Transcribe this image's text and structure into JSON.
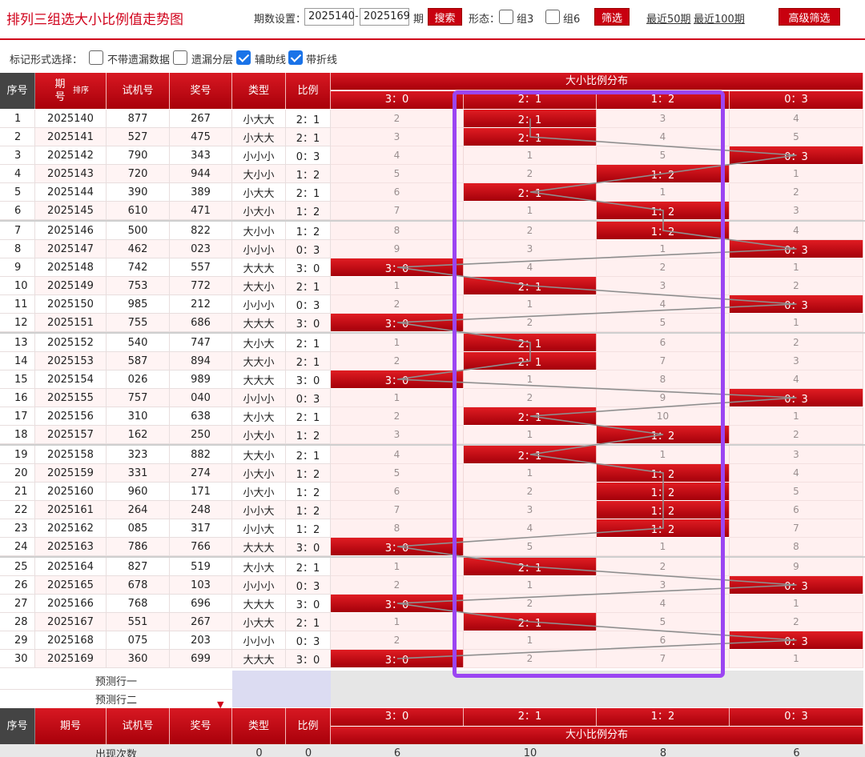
{
  "header": {
    "title": "排列三组选大小比例值走势图",
    "period_label": "期数设置：",
    "period_from": "2025140",
    "dash": "-",
    "period_to": "2025169",
    "period_unit": "期",
    "search_label": "搜索",
    "form_label": "形态：",
    "group3_label": "组3",
    "group6_label": "组6",
    "filter_label": "筛选",
    "recent50": "最近50期",
    "recent100": "最近100期",
    "advanced_label": "高级筛选"
  },
  "mark": {
    "label": "标记形式选择：",
    "opt1": "不带遗漏数据",
    "opt2": "遗漏分层",
    "opt3": "辅助线",
    "opt4": "带折线"
  },
  "cols": {
    "seq": "序号",
    "period": "期号",
    "sort": "排序",
    "test": "试机号",
    "prize": "奖号",
    "type": "类型",
    "ratio": "比例",
    "dist": "大小比例分布",
    "r30": "3：0",
    "r21": "2：1",
    "r12": "1：2",
    "r03": "0：3"
  },
  "rows": [
    {
      "seq": "1",
      "period": "2025140",
      "test": "877",
      "prize": "267",
      "type": "小大大",
      "ratio": "2：1",
      "hit": 1,
      "miss": [
        "2",
        "",
        "3",
        "4"
      ]
    },
    {
      "seq": "2",
      "period": "2025141",
      "test": "527",
      "prize": "475",
      "type": "小大大",
      "ratio": "2：1",
      "hit": 1,
      "miss": [
        "3",
        "",
        "4",
        "5"
      ]
    },
    {
      "seq": "3",
      "period": "2025142",
      "test": "790",
      "prize": "343",
      "type": "小小小",
      "ratio": "0：3",
      "hit": 3,
      "miss": [
        "4",
        "1",
        "5",
        ""
      ]
    },
    {
      "seq": "4",
      "period": "2025143",
      "test": "720",
      "prize": "944",
      "type": "大小小",
      "ratio": "1：2",
      "hit": 2,
      "miss": [
        "5",
        "2",
        "",
        "1"
      ]
    },
    {
      "seq": "5",
      "period": "2025144",
      "test": "390",
      "prize": "389",
      "type": "小大大",
      "ratio": "2：1",
      "hit": 1,
      "miss": [
        "6",
        "",
        "1",
        "2"
      ]
    },
    {
      "seq": "6",
      "period": "2025145",
      "test": "610",
      "prize": "471",
      "type": "小大小",
      "ratio": "1：2",
      "hit": 2,
      "miss": [
        "7",
        "1",
        "",
        "3"
      ]
    },
    {
      "seq": "7",
      "period": "2025146",
      "test": "500",
      "prize": "822",
      "type": "大小小",
      "ratio": "1：2",
      "hit": 2,
      "miss": [
        "8",
        "2",
        "",
        "4"
      ]
    },
    {
      "seq": "8",
      "period": "2025147",
      "test": "462",
      "prize": "023",
      "type": "小小小",
      "ratio": "0：3",
      "hit": 3,
      "miss": [
        "9",
        "3",
        "1",
        ""
      ]
    },
    {
      "seq": "9",
      "period": "2025148",
      "test": "742",
      "prize": "557",
      "type": "大大大",
      "ratio": "3：0",
      "hit": 0,
      "miss": [
        "",
        "4",
        "2",
        "1"
      ]
    },
    {
      "seq": "10",
      "period": "2025149",
      "test": "753",
      "prize": "772",
      "type": "大大小",
      "ratio": "2：1",
      "hit": 1,
      "miss": [
        "1",
        "",
        "3",
        "2"
      ]
    },
    {
      "seq": "11",
      "period": "2025150",
      "test": "985",
      "prize": "212",
      "type": "小小小",
      "ratio": "0：3",
      "hit": 3,
      "miss": [
        "2",
        "1",
        "4",
        ""
      ]
    },
    {
      "seq": "12",
      "period": "2025151",
      "test": "755",
      "prize": "686",
      "type": "大大大",
      "ratio": "3：0",
      "hit": 0,
      "miss": [
        "",
        "2",
        "5",
        "1"
      ]
    },
    {
      "seq": "13",
      "period": "2025152",
      "test": "540",
      "prize": "747",
      "type": "大小大",
      "ratio": "2：1",
      "hit": 1,
      "miss": [
        "1",
        "",
        "6",
        "2"
      ]
    },
    {
      "seq": "14",
      "period": "2025153",
      "test": "587",
      "prize": "894",
      "type": "大大小",
      "ratio": "2：1",
      "hit": 1,
      "miss": [
        "2",
        "",
        "7",
        "3"
      ]
    },
    {
      "seq": "15",
      "period": "2025154",
      "test": "026",
      "prize": "989",
      "type": "大大大",
      "ratio": "3：0",
      "hit": 0,
      "miss": [
        "",
        "1",
        "8",
        "4"
      ]
    },
    {
      "seq": "16",
      "period": "2025155",
      "test": "757",
      "prize": "040",
      "type": "小小小",
      "ratio": "0：3",
      "hit": 3,
      "miss": [
        "1",
        "2",
        "9",
        ""
      ]
    },
    {
      "seq": "17",
      "period": "2025156",
      "test": "310",
      "prize": "638",
      "type": "大小大",
      "ratio": "2：1",
      "hit": 1,
      "miss": [
        "2",
        "",
        "10",
        "1"
      ]
    },
    {
      "seq": "18",
      "period": "2025157",
      "test": "162",
      "prize": "250",
      "type": "小大小",
      "ratio": "1：2",
      "hit": 2,
      "miss": [
        "3",
        "1",
        "",
        "2"
      ]
    },
    {
      "seq": "19",
      "period": "2025158",
      "test": "323",
      "prize": "882",
      "type": "大大小",
      "ratio": "2：1",
      "hit": 1,
      "miss": [
        "4",
        "",
        "1",
        "3"
      ]
    },
    {
      "seq": "20",
      "period": "2025159",
      "test": "331",
      "prize": "274",
      "type": "小大小",
      "ratio": "1：2",
      "hit": 2,
      "miss": [
        "5",
        "1",
        "",
        "4"
      ]
    },
    {
      "seq": "21",
      "period": "2025160",
      "test": "960",
      "prize": "171",
      "type": "小大小",
      "ratio": "1：2",
      "hit": 2,
      "miss": [
        "6",
        "2",
        "",
        "5"
      ]
    },
    {
      "seq": "22",
      "period": "2025161",
      "test": "264",
      "prize": "248",
      "type": "小小大",
      "ratio": "1：2",
      "hit": 2,
      "miss": [
        "7",
        "3",
        "",
        "6"
      ]
    },
    {
      "seq": "23",
      "period": "2025162",
      "test": "085",
      "prize": "317",
      "type": "小小大",
      "ratio": "1：2",
      "hit": 2,
      "miss": [
        "8",
        "4",
        "",
        "7"
      ]
    },
    {
      "seq": "24",
      "period": "2025163",
      "test": "786",
      "prize": "766",
      "type": "大大大",
      "ratio": "3：0",
      "hit": 0,
      "miss": [
        "",
        "5",
        "1",
        "8"
      ]
    },
    {
      "seq": "25",
      "period": "2025164",
      "test": "827",
      "prize": "519",
      "type": "大小大",
      "ratio": "2：1",
      "hit": 1,
      "miss": [
        "1",
        "",
        "2",
        "9"
      ]
    },
    {
      "seq": "26",
      "period": "2025165",
      "test": "678",
      "prize": "103",
      "type": "小小小",
      "ratio": "0：3",
      "hit": 3,
      "miss": [
        "2",
        "1",
        "3",
        ""
      ]
    },
    {
      "seq": "27",
      "period": "2025166",
      "test": "768",
      "prize": "696",
      "type": "大大大",
      "ratio": "3：0",
      "hit": 0,
      "miss": [
        "",
        "2",
        "4",
        "1"
      ]
    },
    {
      "seq": "28",
      "period": "2025167",
      "test": "551",
      "prize": "267",
      "type": "小大大",
      "ratio": "2：1",
      "hit": 1,
      "miss": [
        "1",
        "",
        "5",
        "2"
      ]
    },
    {
      "seq": "29",
      "period": "2025168",
      "test": "075",
      "prize": "203",
      "type": "小小小",
      "ratio": "0：3",
      "hit": 3,
      "miss": [
        "2",
        "1",
        "6",
        ""
      ]
    },
    {
      "seq": "30",
      "period": "2025169",
      "test": "360",
      "prize": "699",
      "type": "大大大",
      "ratio": "3：0",
      "hit": 0,
      "miss": [
        "",
        "2",
        "7",
        "1"
      ]
    }
  ],
  "predict": {
    "row1": "预测行一",
    "row2": "预测行二"
  },
  "stats": {
    "label": "出现次数",
    "type": "0",
    "ratio": "0",
    "c30": "6",
    "c21": "10",
    "c12": "8",
    "c03": "6"
  },
  "colors": {
    "accent": "#d0021b",
    "highlight": "#9b45f2"
  }
}
